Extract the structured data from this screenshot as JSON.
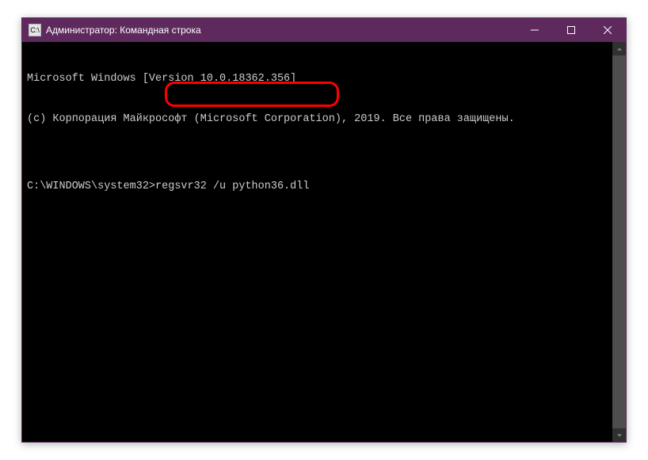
{
  "window": {
    "title": "Администратор: Командная строка",
    "icon_abbrev": "C:\\"
  },
  "terminal": {
    "lines": [
      "Microsoft Windows [Version 10.0.18362.356]",
      "(c) Корпорация Майкрософт (Microsoft Corporation), 2019. Все права защищены.",
      "",
      "C:\\WINDOWS\\system32>regsvr32 /u python36.dll"
    ]
  }
}
